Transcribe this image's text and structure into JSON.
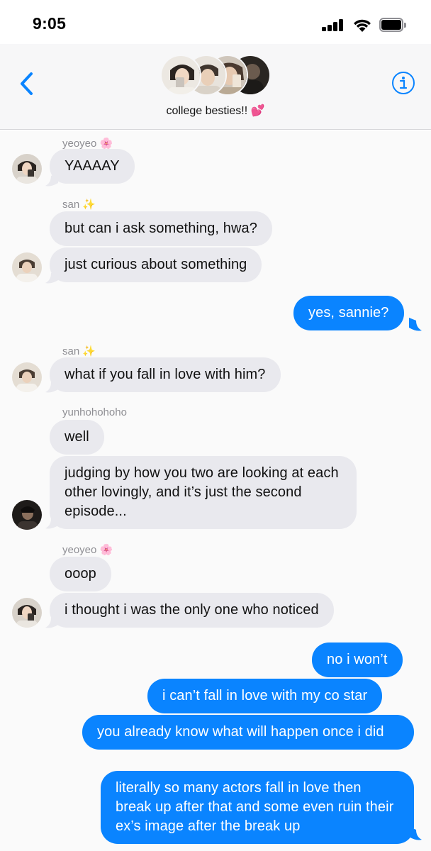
{
  "status_bar": {
    "time": "9:05"
  },
  "header": {
    "group_name": "college besties!! 💕"
  },
  "messages": [
    {
      "sender": "yeoyeo 🌸",
      "text": "YAAAAY"
    },
    {
      "sender": "san ✨",
      "text": "but can i ask something, hwa?"
    },
    {
      "text": "just curious about something"
    },
    {
      "text": "yes, sannie?"
    },
    {
      "sender": "san ✨",
      "text": "what if you fall in love with him?"
    },
    {
      "sender": "yunhohohoho",
      "text": "well"
    },
    {
      "text": "judging by how you two are looking at each other lovingly, and it’s just the second episode..."
    },
    {
      "sender": "yeoyeo 🌸",
      "text": "ooop"
    },
    {
      "text": "i thought i was the only one who noticed"
    },
    {
      "text": "no i won’t"
    },
    {
      "text": "i can’t fall in love with my co star"
    },
    {
      "text": "you already know what will happen once i did"
    },
    {
      "text": "literally so many actors fall in love then break up after that and some even ruin their ex’s image after the break up"
    }
  ]
}
